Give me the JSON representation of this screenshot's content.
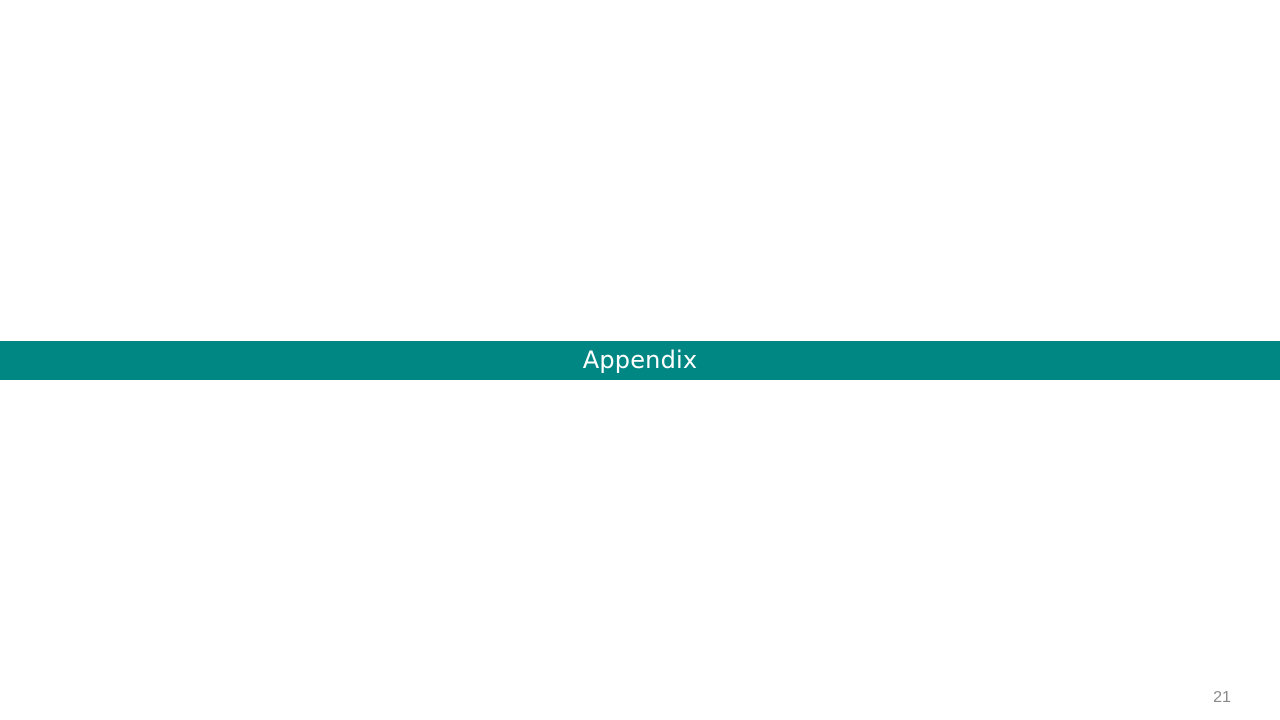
{
  "slide": {
    "section_title": "Appendix",
    "page_number": "21"
  },
  "colors": {
    "banner": "#008784",
    "banner_text": "#ffffff",
    "page_number": "#8a8a8a",
    "background": "#ffffff"
  }
}
